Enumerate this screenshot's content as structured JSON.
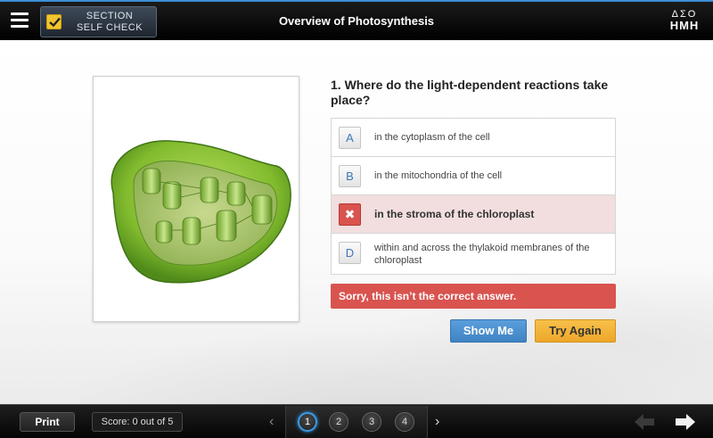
{
  "header": {
    "menu_icon": "hamburger-menu-icon",
    "section_button": {
      "line1": "SECTION",
      "line2": "SELF CHECK",
      "icon": "checkbox-checked-icon"
    },
    "title": "Overview of Photosynthesis",
    "logo": {
      "mark": "ΔΣΟ",
      "word": "HMH"
    }
  },
  "question": {
    "number_and_text": "1. Where do the light-dependent reactions take place?",
    "image_alt": "chloroplast illustration",
    "choices": [
      {
        "letter": "A",
        "text": "in the cytoplasm of the cell",
        "state": "default"
      },
      {
        "letter": "B",
        "text": "in the mitochondria of the cell",
        "state": "default"
      },
      {
        "letter": "✖",
        "text": "in the stroma of the chloroplast",
        "state": "wrong"
      },
      {
        "letter": "D",
        "text": "within and across the thylakoid membranes of the chloroplast",
        "state": "default"
      }
    ],
    "feedback": "Sorry, this isn’t the correct answer."
  },
  "buttons": {
    "show_me": "Show Me",
    "try_again": "Try Again"
  },
  "footer": {
    "print": "Print",
    "score": "Score: 0 out of 5",
    "pages": [
      "1",
      "2",
      "3",
      "4"
    ],
    "active_page": "1"
  },
  "colors": {
    "accent_blue": "#3a9ae6",
    "wrong_red": "#d9534f",
    "try_again_yellow": "#f7c04a",
    "show_me_blue": "#4a90d2"
  }
}
